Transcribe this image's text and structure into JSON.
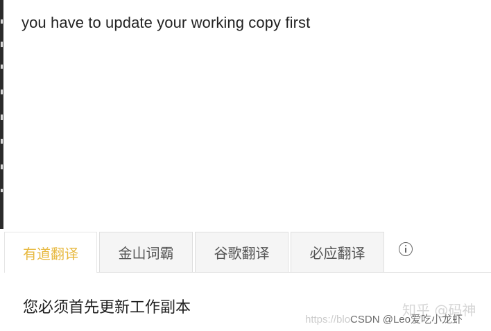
{
  "source": {
    "text": "you have to update your working copy first"
  },
  "tabs": [
    {
      "label": "有道翻译",
      "active": true
    },
    {
      "label": "金山词霸",
      "active": false
    },
    {
      "label": "谷歌翻译",
      "active": false
    },
    {
      "label": "必应翻译",
      "active": false
    }
  ],
  "info_icon": "info-icon",
  "result": {
    "text": "您必须首先更新工作副本"
  },
  "watermarks": {
    "zhihu": "知乎 @码神",
    "csdn_url": "https://blo",
    "csdn_user": "CSDN @Leo爱吃小龙虾"
  },
  "colors": {
    "active_tab": "#e7b83e",
    "tab_bg": "#f5f5f5",
    "text": "#222222"
  }
}
